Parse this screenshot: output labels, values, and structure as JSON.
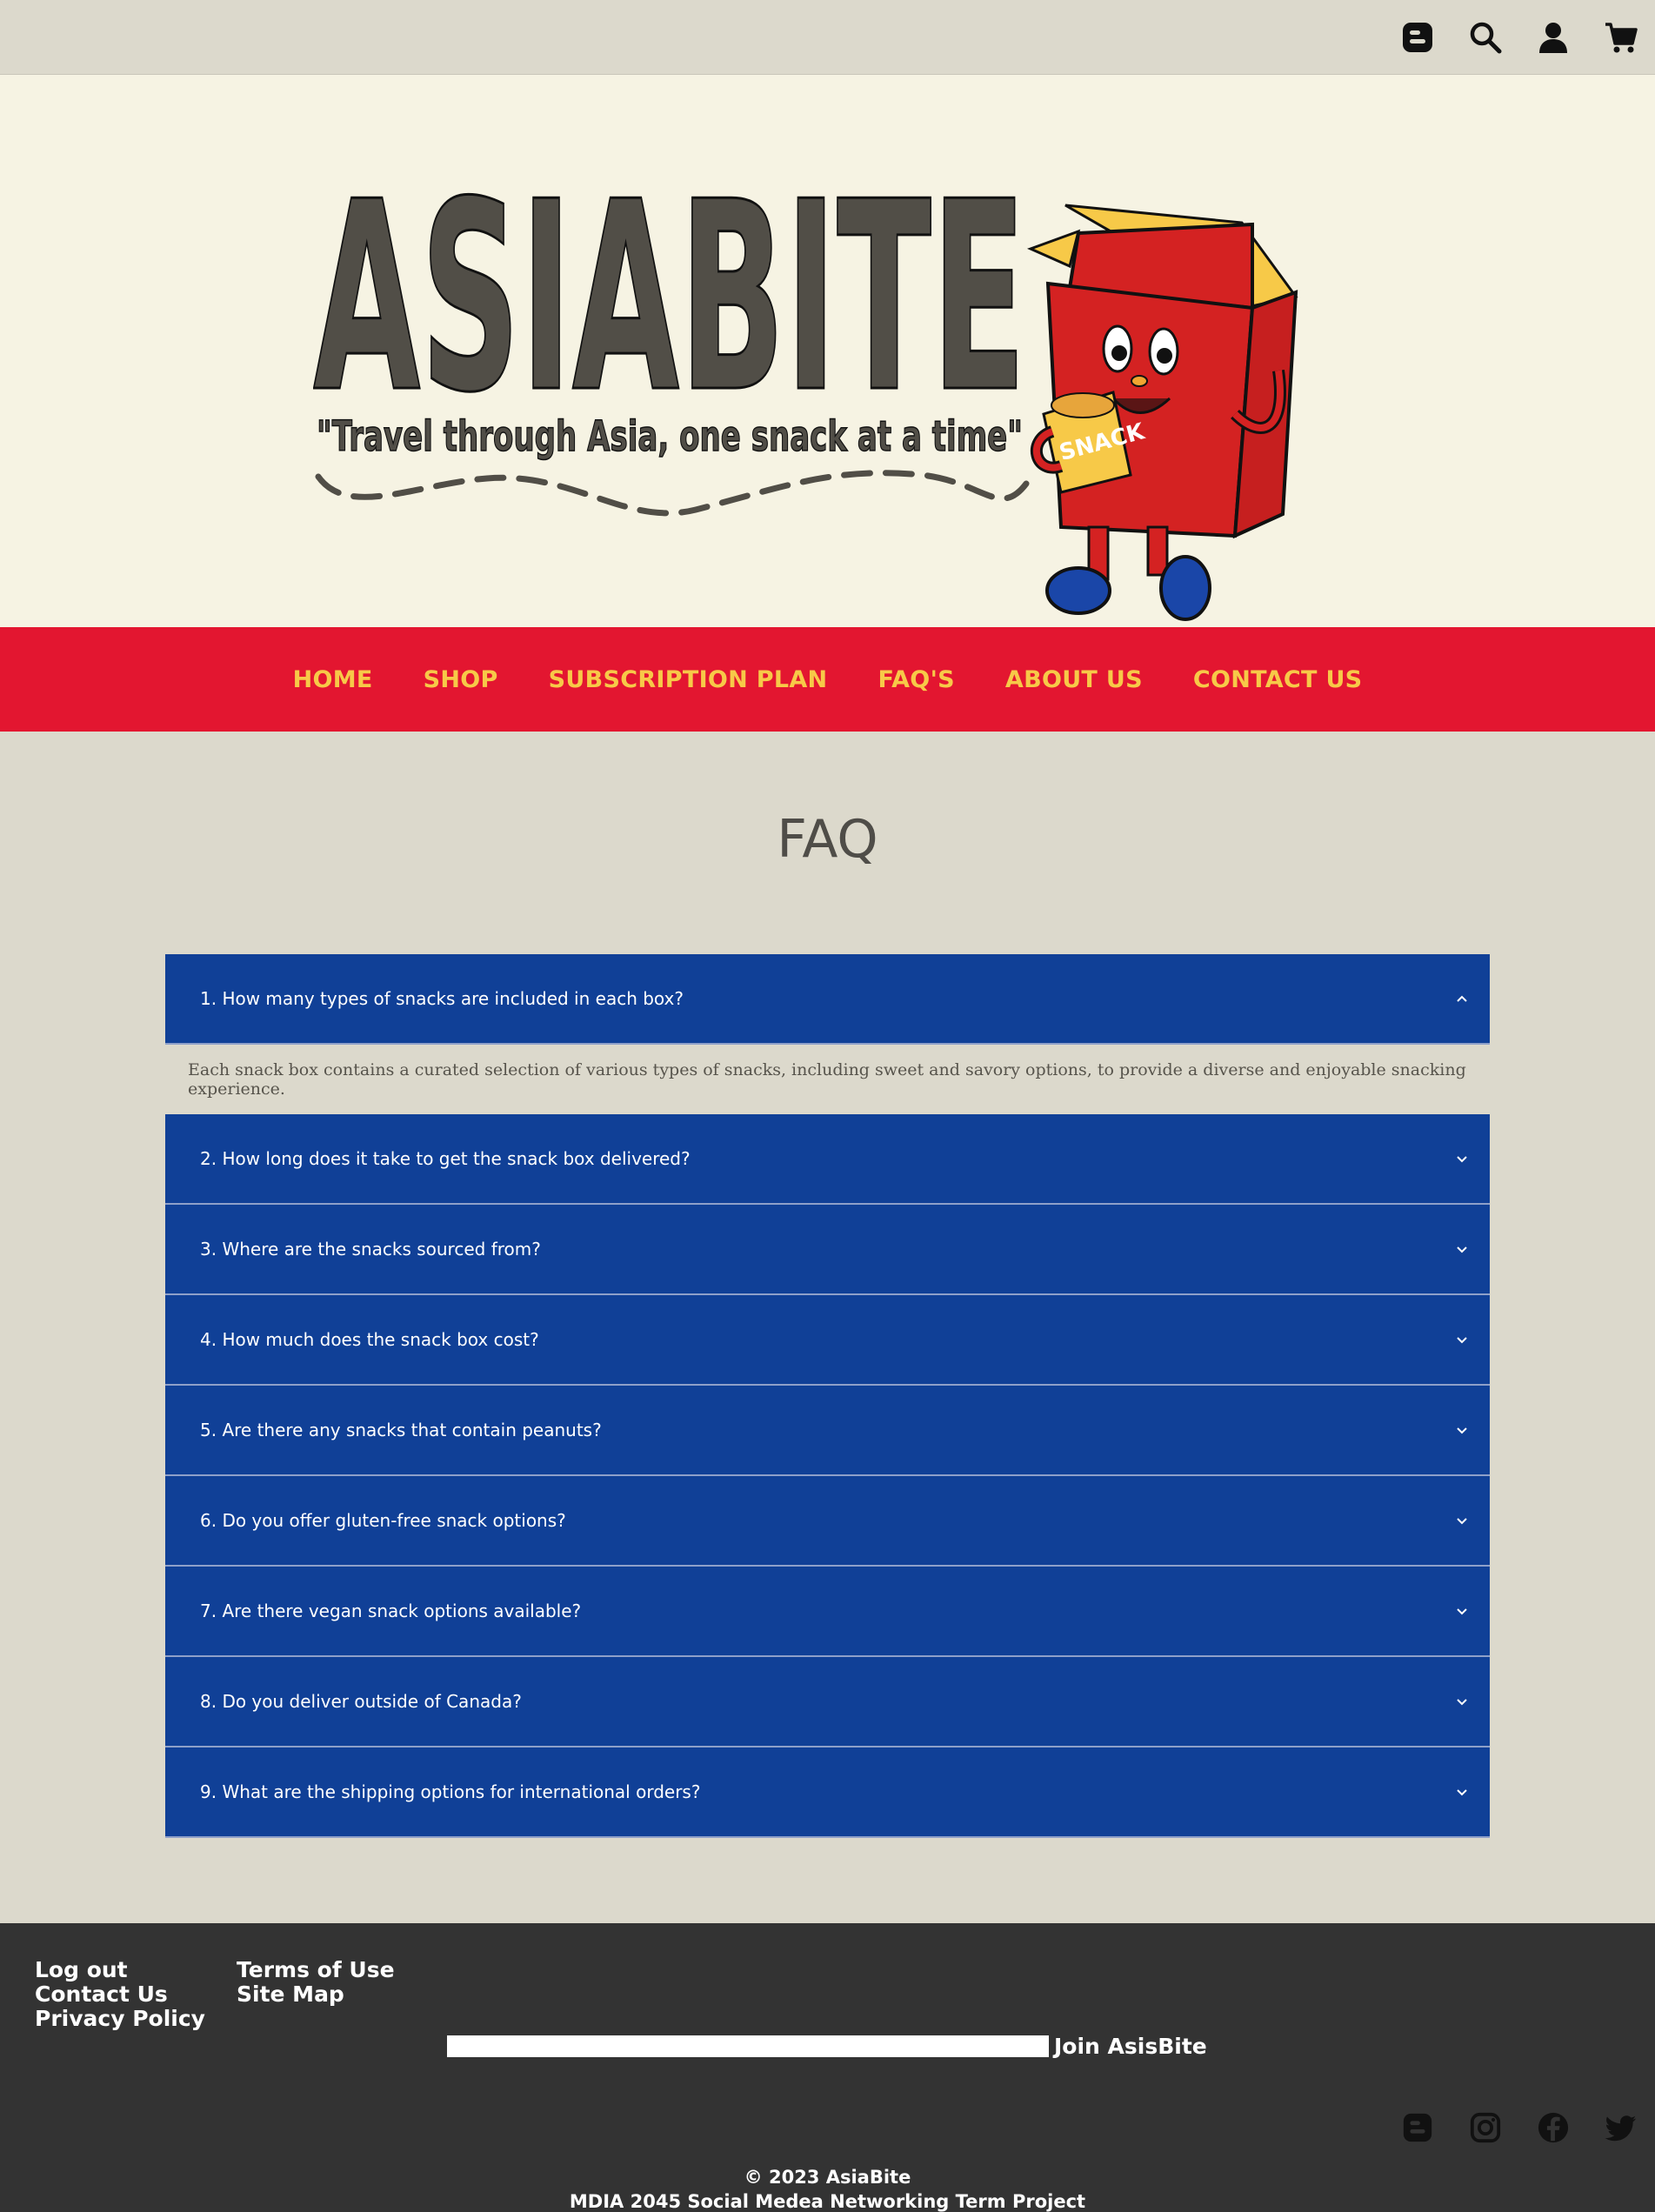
{
  "header": {
    "icons": [
      "blogger-icon",
      "search-icon",
      "user-icon",
      "cart-icon"
    ]
  },
  "logo": {
    "brand": "ASIABITE",
    "tagline": "\"Travel through Asia, one snack at a time\"",
    "bag_label": "SNACK"
  },
  "nav": {
    "items": [
      "HOME",
      "SHOP",
      "SUBSCRIPTION PLAN",
      "FAQ'S",
      "ABOUT US",
      "CONTACT US"
    ]
  },
  "faq": {
    "title": "FAQ",
    "items": [
      {
        "question": "1. How many types of snacks are included in each box?",
        "answer": "Each snack box contains a curated selection of various types of snacks, including sweet and savory options, to provide a diverse and enjoyable snacking experience.",
        "expanded": true
      },
      {
        "question": "2. How long does it take to get the snack box delivered?",
        "expanded": false
      },
      {
        "question": "3. Where are the snacks sourced from?",
        "expanded": false
      },
      {
        "question": "4. How much does the snack box cost?",
        "expanded": false
      },
      {
        "question": "5. Are there any snacks that contain peanuts?",
        "expanded": false
      },
      {
        "question": "6. Do you offer gluten-free snack options?",
        "expanded": false
      },
      {
        "question": "7. Are there vegan snack options available?",
        "expanded": false
      },
      {
        "question": "8. Do you deliver outside of Canada?",
        "expanded": false
      },
      {
        "question": "9. What are the shipping options for international orders?",
        "expanded": false
      }
    ]
  },
  "footer": {
    "links_col1": [
      "Log out",
      "Contact Us",
      "Privacy Policy"
    ],
    "links_col2": [
      "Terms of Use",
      "Site Map"
    ],
    "join_label": "Join AsisBite",
    "join_input_value": "",
    "social_icons": [
      "blogger-icon",
      "instagram-icon",
      "facebook-icon",
      "twitter-icon"
    ],
    "copyright": "© 2023 AsiaBite",
    "project": "MDIA 2045 Social Medea Networking Term Project"
  },
  "colors": {
    "nav_bg": "#e31630",
    "nav_text": "#f7c948",
    "faq_bg": "#104097",
    "footer_bg": "#333333",
    "page_bg": "#dcd9cc",
    "hero_bg": "#f6f3e3"
  }
}
